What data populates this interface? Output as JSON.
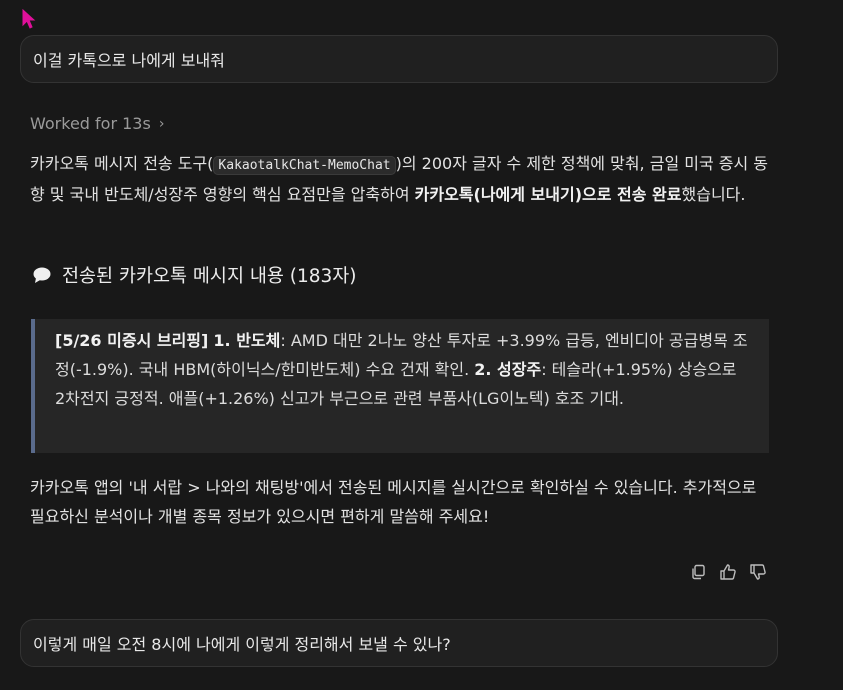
{
  "messages": {
    "user_first": "이걸 카톡으로 나에게 보내줘",
    "user_second": "이렇게 매일 오전 8시에 나에게 이렇게 정리해서 보낼 수 있나?"
  },
  "worked": {
    "label": "Worked for 13s",
    "chevron": "›"
  },
  "intro": {
    "part1": "카카오톡 메시지 전송 도구(",
    "code": "KakaotalkChat-MemoChat",
    "part2": ")의 200자 글자 수 제한 정책에 맞춰, 금일 미국 증시 동향 및 국내 반도체/성장주 영향의 핵심 요점만을 압축하여 ",
    "bold": "카카오톡(나에게 보내기)으로 전송 완료",
    "part3": "했습니다."
  },
  "heading": {
    "icon": "speech-bubble-icon",
    "text": "전송된 카카오톡 메시지 내용 (183자)"
  },
  "quote": {
    "tag": "[5/26 미증시 브리핑]",
    "s1_label": "1. 반도체",
    "s1_text": ": AMD 대만 2나노 양산 투자로 +3.99% 급등, 엔비디아 공급병목 조정(-1.9%). 국내 HBM(하이닉스/한미반도체) 수요 건재 확인. ",
    "s2_label": "2. 성장주",
    "s2_text": ": 테슬라(+1.95%) 상승으로 2차전지 긍정적. 애플(+1.26%) 신고가 부근으로 관련 부품사(LG이노텍) 호조 기대."
  },
  "outro": "카카오톡 앱의 '내 서랍 > 나와의 채팅방'에서 전송된 메시지를 실시간으로 확인하실 수 있습니다. 추가적으로 필요하신 분석이나 개별 종목 정보가 있으시면 편하게 말씀해 주세요!",
  "actions": {
    "copy_icon": "copy-icon",
    "thumbs_up_icon": "thumbs-up-icon",
    "thumbs_down_icon": "thumbs-down-icon"
  },
  "colors": {
    "background": "#181818",
    "bubble": "#202020",
    "quote_bg": "#262626",
    "quote_bar": "#5a6b8c",
    "cursor": "#e0109a"
  }
}
